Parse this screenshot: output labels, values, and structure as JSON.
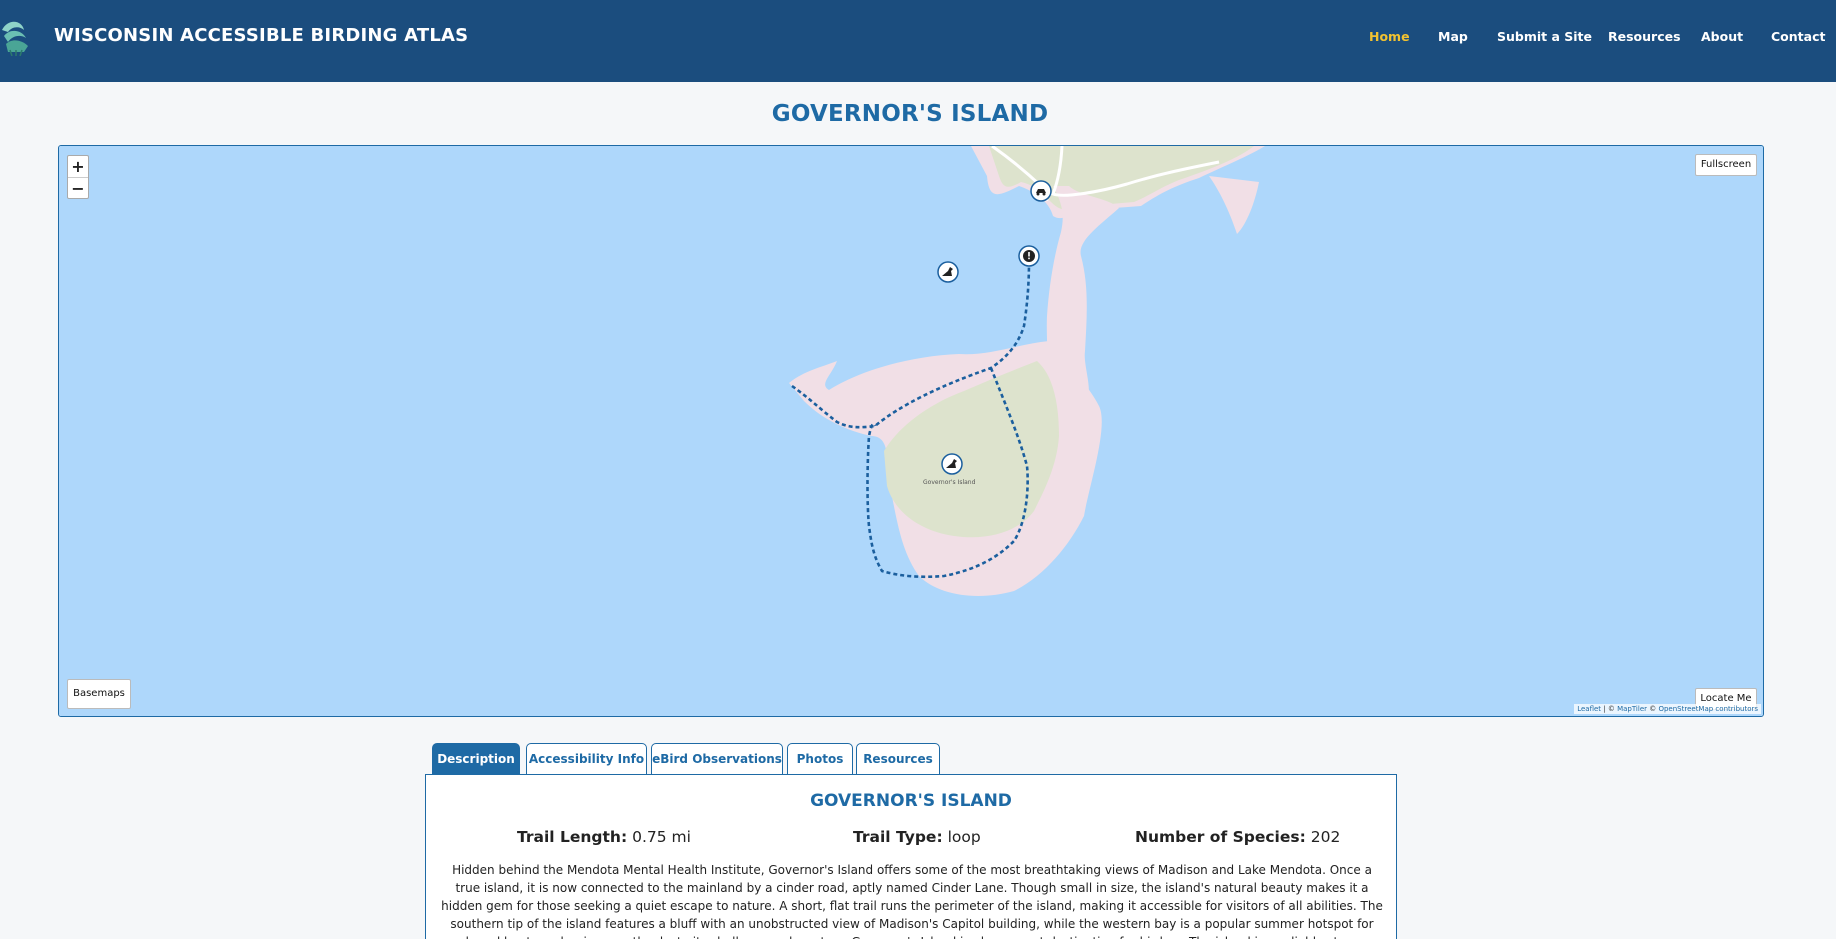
{
  "header": {
    "site_title": "WISCONSIN ACCESSIBLE BIRDING ATLAS",
    "nav": [
      {
        "label": "Home",
        "active": true
      },
      {
        "label": "Map",
        "active": false
      },
      {
        "label": "Submit a Site",
        "active": false
      },
      {
        "label": "Resources",
        "active": false
      },
      {
        "label": "About",
        "active": false
      },
      {
        "label": "Contact",
        "active": false
      }
    ]
  },
  "page": {
    "title": "GOVERNOR'S ISLAND"
  },
  "map": {
    "zoom_in": "+",
    "zoom_out": "−",
    "fullscreen_label": "Fullscreen",
    "basemaps_label": "Basemaps",
    "locate_label": "Locate Me",
    "attribution": {
      "leaflet": "Leaflet",
      "sep1": " | © ",
      "maptiler": "MapTiler",
      "sep2": " © ",
      "osm": "OpenStreetMap contributors"
    },
    "island_label": "Governor's Island",
    "markers": [
      "parking-icon",
      "info-icon",
      "bird-icon",
      "bird-icon"
    ],
    "colors": {
      "water": "#aed7fb",
      "land": "#e1e6d3",
      "shore": "#f1dfe6",
      "trail": "#1b5f9e"
    }
  },
  "tabs": [
    {
      "label": "Description",
      "active": true
    },
    {
      "label": "Accessibility Info",
      "active": false
    },
    {
      "label": "eBird Observations",
      "active": false
    },
    {
      "label": "Photos",
      "active": false
    },
    {
      "label": "Resources",
      "active": false
    }
  ],
  "description": {
    "title": "GOVERNOR'S ISLAND",
    "trail_length_label": "Trail Length:",
    "trail_length_value": "0.75 mi",
    "trail_type_label": "Trail Type:",
    "trail_type_value": "loop",
    "species_label": "Number of Species:",
    "species_value": "202",
    "text": "Hidden behind the Mendota Mental Health Institute, Governor's Island offers some of the most breathtaking views of Madison and Lake Mendota. Once a true island, it is now connected to the mainland by a cinder road, aptly named Cinder Lane. Though small in size, the island's natural beauty makes it a hidden gem for those seeking a quiet escape to nature. A short, flat trail runs the perimeter of the island, making it accessible for visitors of all abilities. The southern tip of the island features a bluff with an unobstructed view of Madison's Capitol building, while the western bay is a popular summer hotspot for anchored boats and swimmers thanks to its shallow, sandy waters. Governor's Island is also a great destination for birders. The island is a reliable stopover for migratory birds, particularly neotropical songbirds like"
  }
}
